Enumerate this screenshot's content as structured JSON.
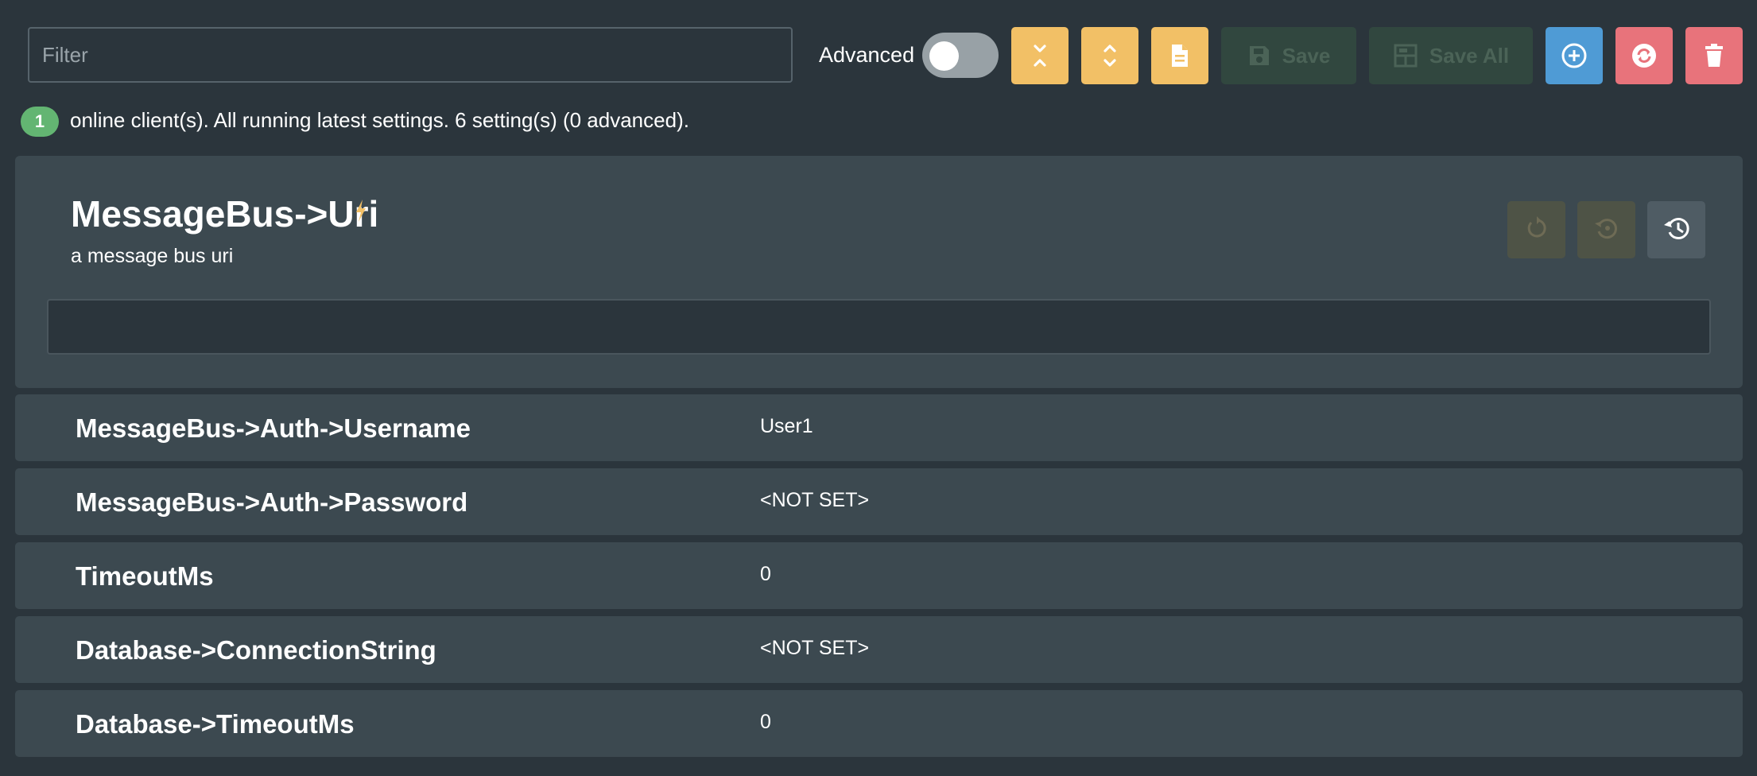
{
  "toolbar": {
    "filter_placeholder": "Filter",
    "advanced_label": "Advanced",
    "advanced_enabled": false,
    "save_label": "Save",
    "save_all_label": "Save All",
    "icons": [
      "collapse-all-icon",
      "expand-all-icon",
      "document-icon",
      "save-icon",
      "save-all-icon",
      "add-icon",
      "sync-icon",
      "delete-icon"
    ]
  },
  "status": {
    "client_count": "1",
    "text": "online client(s). All running latest settings. 6 setting(s) (0 advanced)."
  },
  "expanded_setting": {
    "name": "MessageBus->Uri",
    "description": "a message bus uri",
    "value": "",
    "icons": [
      "bolt-icon",
      "revert-icon",
      "reset-icon",
      "history-icon"
    ]
  },
  "settings": [
    {
      "name": "MessageBus->Auth->Username",
      "value": "User1"
    },
    {
      "name": "MessageBus->Auth->Password",
      "value": "<NOT SET>"
    },
    {
      "name": "TimeoutMs",
      "value": "0"
    },
    {
      "name": "Database->ConnectionString",
      "value": "<NOT SET>"
    },
    {
      "name": "Database->TimeoutMs",
      "value": "0"
    }
  ],
  "colors": {
    "background": "#2b353c",
    "card": "#3c4950",
    "yellow": "#f2c066",
    "blue": "#4f9bd5",
    "red": "#e8737b",
    "badge_green": "#63b572"
  }
}
